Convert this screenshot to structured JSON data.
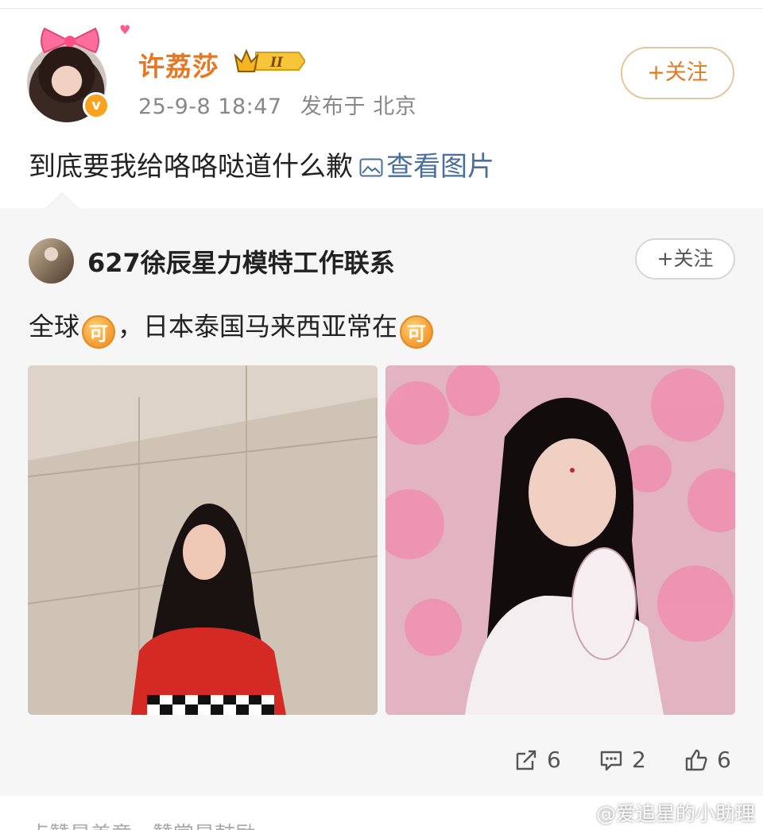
{
  "post": {
    "username": "许荔莎",
    "level_badge": "II",
    "timestamp": "25-9-8 18:47",
    "location": "发布于 北京",
    "follow_label": "+关注",
    "text": "到底要我给咯咯哒道什么歉",
    "view_picture_label": "查看图片"
  },
  "repost": {
    "author": "627徐辰星力模特工作联系",
    "follow_label": "+关注",
    "text_part1": "全球",
    "emoji_1": "可",
    "text_part2": "，日本泰国马来西亚常在",
    "emoji_2": "可",
    "actions": {
      "share_count": "6",
      "comment_count": "2",
      "like_count": "6"
    }
  },
  "footer": {
    "text": "点赞是美意，赞赏是鼓励",
    "watermark": "@爱追星的小助理"
  },
  "colors": {
    "username": "#e87722",
    "follow_border": "#e4c7a1",
    "link": "#4a6f9c",
    "repost_bg": "#f6f6f6"
  }
}
